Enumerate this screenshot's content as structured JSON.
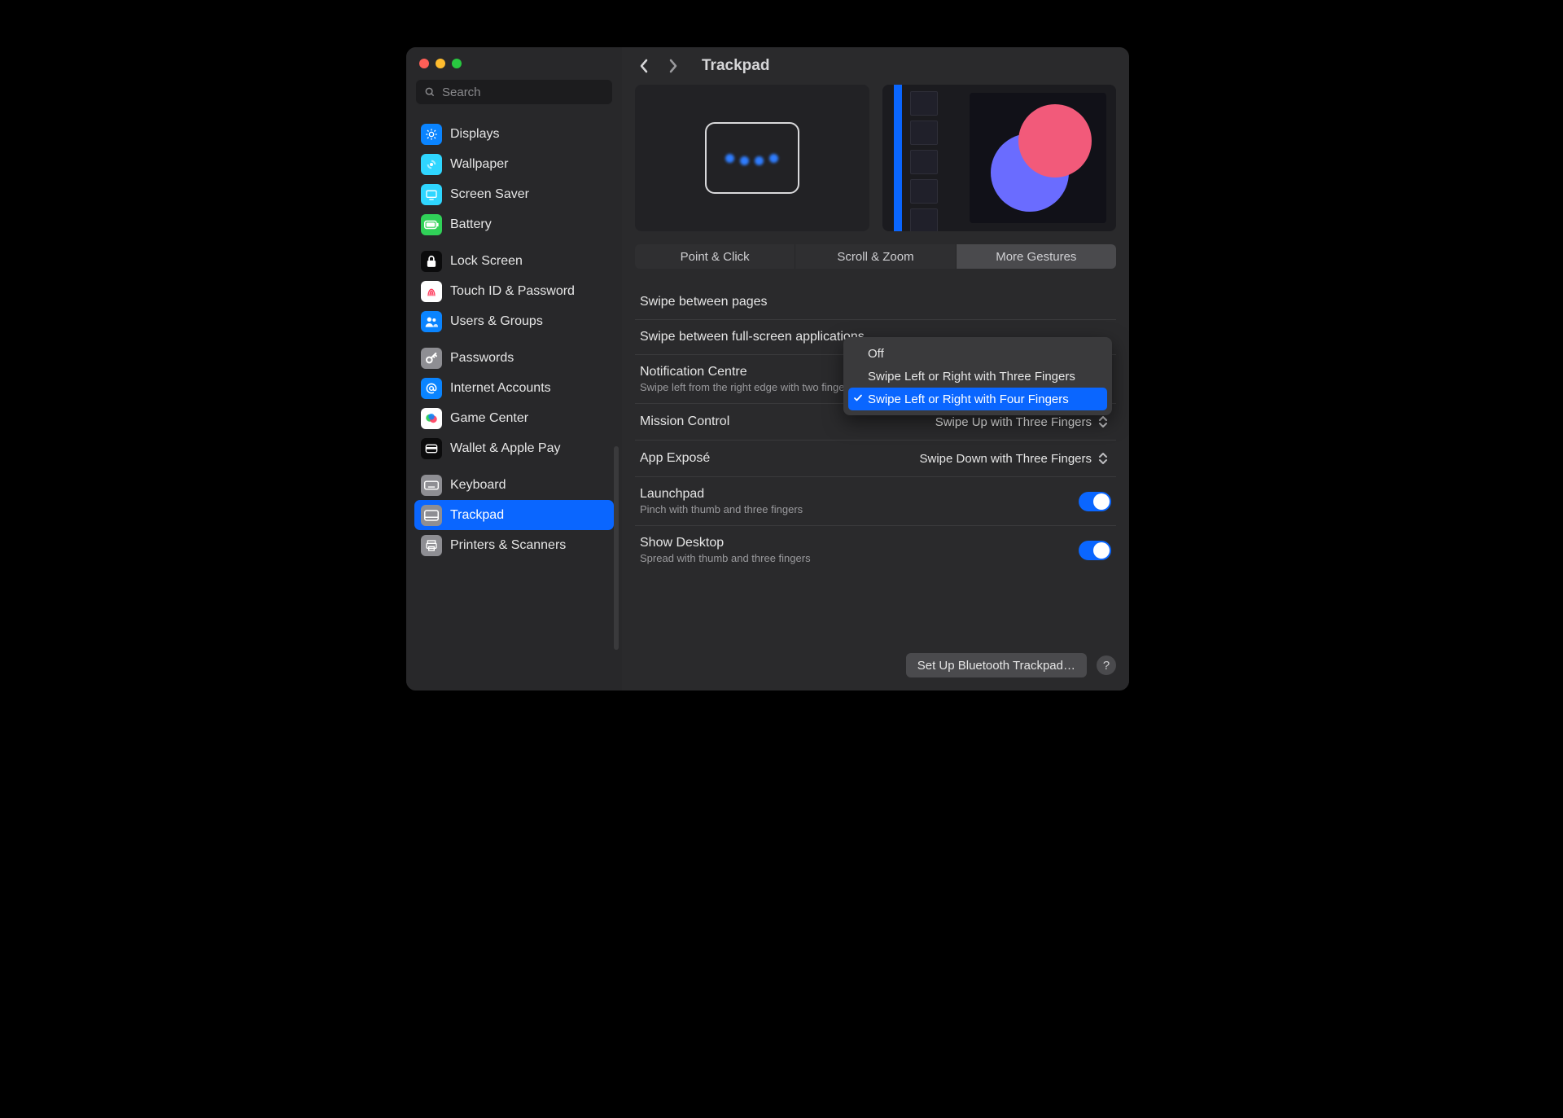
{
  "search_placeholder": "Search",
  "page_title": "Trackpad",
  "sidebar": {
    "groups": [
      [
        {
          "label": "Displays",
          "icon": "displays",
          "bg": "#0a84ff",
          "fg": "#ffffff"
        },
        {
          "label": "Wallpaper",
          "icon": "wallpaper",
          "bg": "#2fd6ff",
          "fg": "#ffffff"
        },
        {
          "label": "Screen Saver",
          "icon": "screensaver",
          "bg": "#2fd6ff",
          "fg": "#ffffff"
        },
        {
          "label": "Battery",
          "icon": "battery",
          "bg": "#30d158",
          "fg": "#ffffff"
        }
      ],
      [
        {
          "label": "Lock Screen",
          "icon": "lock",
          "bg": "#0b0b0c",
          "fg": "#ffffff"
        },
        {
          "label": "Touch ID & Password",
          "icon": "touchid",
          "bg": "#ffffff",
          "fg": "#ff3b5c"
        },
        {
          "label": "Users & Groups",
          "icon": "users",
          "bg": "#0a84ff",
          "fg": "#ffffff"
        }
      ],
      [
        {
          "label": "Passwords",
          "icon": "key",
          "bg": "#8e8e93",
          "fg": "#ffffff"
        },
        {
          "label": "Internet Accounts",
          "icon": "at",
          "bg": "#0a84ff",
          "fg": "#ffffff"
        },
        {
          "label": "Game Center",
          "icon": "gamecenter",
          "bg": "#ffffff",
          "fg": "#ff3b5c"
        },
        {
          "label": "Wallet & Apple Pay",
          "icon": "wallet",
          "bg": "#0b0b0c",
          "fg": "#ffffff"
        }
      ],
      [
        {
          "label": "Keyboard",
          "icon": "keyboard",
          "bg": "#8e8e93",
          "fg": "#ffffff"
        },
        {
          "label": "Trackpad",
          "icon": "trackpad",
          "bg": "#8e8e93",
          "fg": "#ffffff",
          "selected": true
        },
        {
          "label": "Printers & Scanners",
          "icon": "printer",
          "bg": "#8e8e93",
          "fg": "#ffffff"
        }
      ]
    ]
  },
  "tabs": [
    "Point & Click",
    "Scroll & Zoom",
    "More Gestures"
  ],
  "active_tab": 2,
  "settings": {
    "swipe_pages": {
      "label": "Swipe between pages"
    },
    "swipe_apps": {
      "label": "Swipe between full-screen applications"
    },
    "notif": {
      "label": "Notification Centre",
      "sub": "Swipe left from the right edge with two fingers",
      "on": true
    },
    "mission": {
      "label": "Mission Control",
      "value": "Swipe Up with Three Fingers"
    },
    "expose": {
      "label": "App Exposé",
      "value": "Swipe Down with Three Fingers"
    },
    "launchpad": {
      "label": "Launchpad",
      "sub": "Pinch with thumb and three fingers",
      "on": true
    },
    "desktop": {
      "label": "Show Desktop",
      "sub": "Spread with thumb and three fingers",
      "on": true
    }
  },
  "menu": {
    "items": [
      "Off",
      "Swipe Left or Right with Three Fingers",
      "Swipe Left or Right with Four Fingers"
    ],
    "selected": 2
  },
  "footer": {
    "setup_btn": "Set Up Bluetooth Trackpad…",
    "help": "?"
  }
}
